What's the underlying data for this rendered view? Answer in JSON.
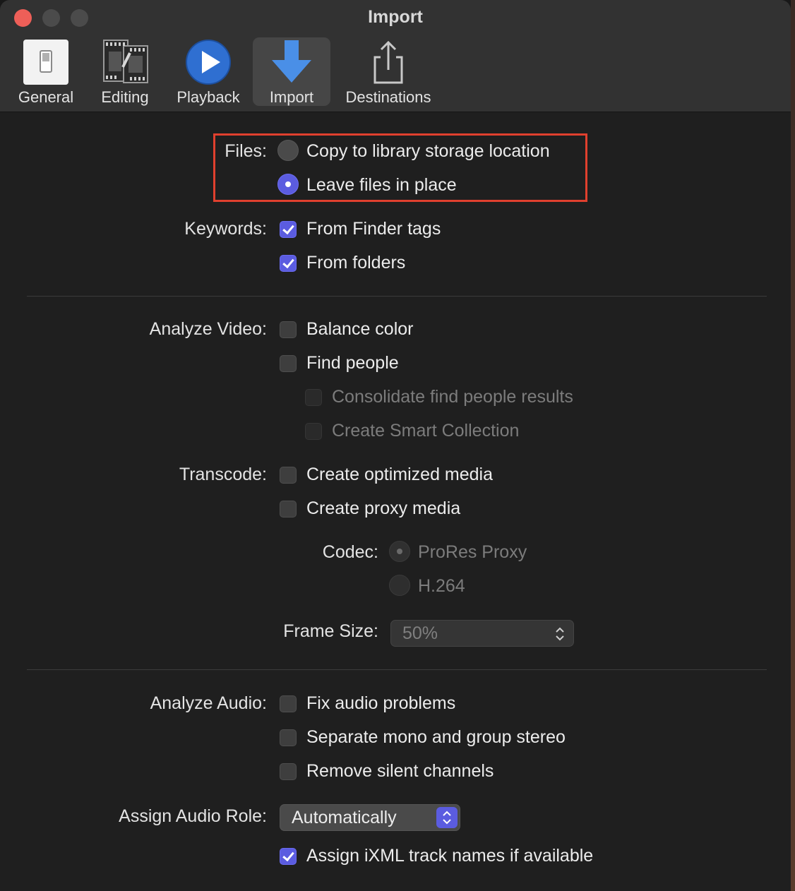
{
  "window": {
    "title": "Import"
  },
  "toolbar": {
    "items": [
      {
        "label": "General",
        "icon": "switch-icon"
      },
      {
        "label": "Editing",
        "icon": "film-strip-icon"
      },
      {
        "label": "Playback",
        "icon": "play-icon"
      },
      {
        "label": "Import",
        "icon": "down-arrow-icon",
        "selected": true
      },
      {
        "label": "Destinations",
        "icon": "share-icon"
      }
    ]
  },
  "files": {
    "label": "Files:",
    "options": [
      {
        "text": "Copy to library storage location",
        "selected": false
      },
      {
        "text": "Leave files in place",
        "selected": true
      }
    ]
  },
  "keywords": {
    "label": "Keywords:",
    "options": [
      {
        "text": "From Finder tags",
        "checked": true
      },
      {
        "text": "From folders",
        "checked": true
      }
    ]
  },
  "analyze_video": {
    "label": "Analyze Video:",
    "options": [
      {
        "text": "Balance color",
        "checked": false
      },
      {
        "text": "Find people",
        "checked": false
      },
      {
        "text": "Consolidate find people results",
        "checked": false,
        "enabled": false
      },
      {
        "text": "Create Smart Collection",
        "checked": false,
        "enabled": false
      }
    ]
  },
  "transcode": {
    "label": "Transcode:",
    "options": [
      {
        "text": "Create optimized media",
        "checked": false
      },
      {
        "text": "Create proxy media",
        "checked": false
      }
    ],
    "codec": {
      "label": "Codec:",
      "options": [
        {
          "text": "ProRes Proxy",
          "selected": true
        },
        {
          "text": "H.264",
          "selected": false
        }
      ],
      "enabled": false
    },
    "frame_size": {
      "label": "Frame Size:",
      "value": "50%",
      "enabled": false
    }
  },
  "analyze_audio": {
    "label": "Analyze Audio:",
    "options": [
      {
        "text": "Fix audio problems",
        "checked": false
      },
      {
        "text": "Separate mono and group stereo",
        "checked": false
      },
      {
        "text": "Remove silent channels",
        "checked": false
      }
    ]
  },
  "audio_role": {
    "label": "Assign Audio Role:",
    "value": "Automatically",
    "ixml": {
      "text": "Assign iXML track names if available",
      "checked": true
    }
  },
  "colors": {
    "accent": "#5b5ce0",
    "highlight": "#e0402e"
  }
}
